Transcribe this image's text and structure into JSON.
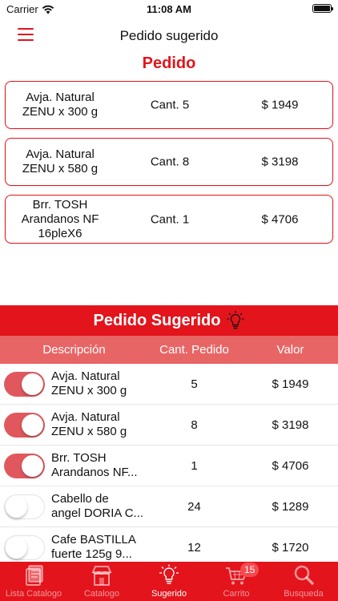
{
  "status_bar": {
    "carrier": "Carrier",
    "time": "11:08 AM"
  },
  "nav": {
    "title": "Pedido sugerido"
  },
  "order_section": {
    "title": "Pedido",
    "items": [
      {
        "name": "Avja. Natural ZENU x 300 g",
        "qty": "Cant. 5",
        "price": "$ 1949"
      },
      {
        "name": "Avja. Natural ZENU x 580 g",
        "qty": "Cant. 8",
        "price": "$ 3198"
      },
      {
        "name": "Brr. TOSH Arandanos NF 16pleX6",
        "qty": "Cant. 1",
        "price": "$ 4706"
      }
    ]
  },
  "suggested": {
    "title": "Pedido Sugerido",
    "columns": {
      "description": "Descripción",
      "qty": "Cant. Pedido",
      "value": "Valor"
    },
    "rows": [
      {
        "enabled": true,
        "name_line1": "Avja. Natural",
        "name_line2": "ZENU x 300 g",
        "qty": "5",
        "value": "$ 1949"
      },
      {
        "enabled": true,
        "name_line1": "Avja. Natural",
        "name_line2": "ZENU x 580 g",
        "qty": "8",
        "value": "$ 3198"
      },
      {
        "enabled": true,
        "name_line1": "Brr. TOSH",
        "name_line2": "Arandanos NF...",
        "qty": "1",
        "value": "$ 4706"
      },
      {
        "enabled": false,
        "name_line1": "Cabello de",
        "name_line2": "angel DORIA C...",
        "qty": "24",
        "value": "$ 1289"
      },
      {
        "enabled": false,
        "name_line1": "Cafe BASTILLA",
        "name_line2": "fuerte 125g 9...",
        "qty": "12",
        "value": "$ 1720"
      }
    ]
  },
  "tabs": [
    {
      "label": "Lista Catalogo",
      "icon": "catalog-list-icon",
      "active": false
    },
    {
      "label": "Catalogo",
      "icon": "store-icon",
      "active": false
    },
    {
      "label": "Sugerido",
      "icon": "lightbulb-icon",
      "active": true
    },
    {
      "label": "Carrito",
      "icon": "cart-icon",
      "active": false,
      "badge": "15"
    },
    {
      "label": "Busqueda",
      "icon": "search-icon",
      "active": false
    }
  ],
  "colors": {
    "brand_red": "#e3141c",
    "header_pink": "#e86566",
    "toggle_on": "#e0585d"
  }
}
